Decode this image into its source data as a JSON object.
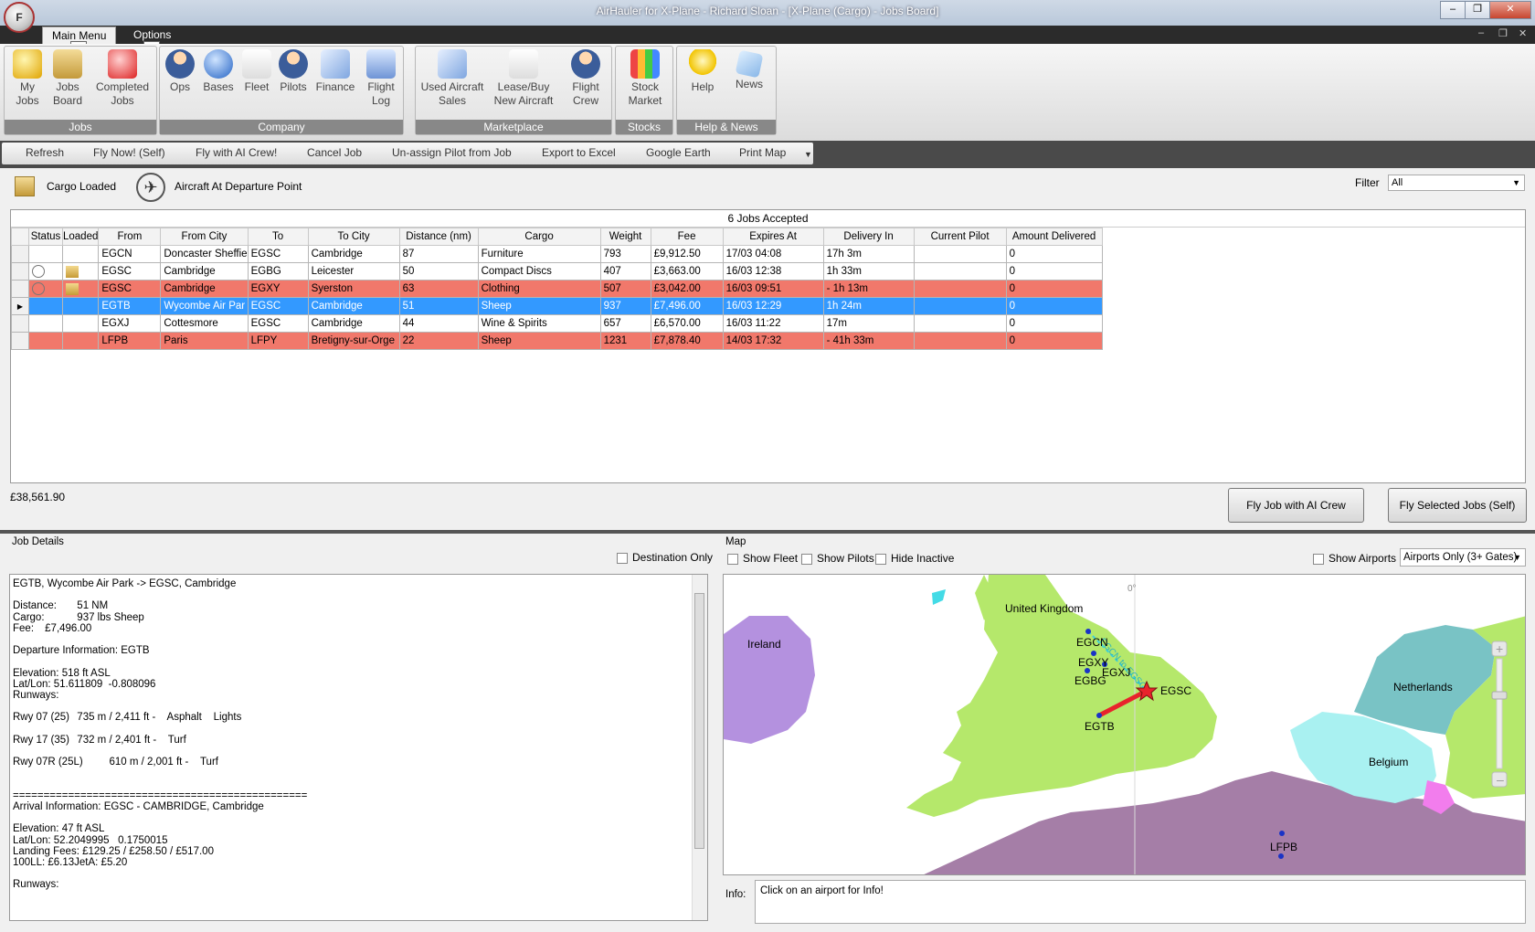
{
  "window": {
    "title": "AirHauler for X-Plane - Richard Sloan - [X-Plane (Cargo) - Jobs Board]",
    "app_icon_letter": "F"
  },
  "ribbon_tabs": {
    "main": "Main Menu",
    "options": "Options",
    "main_keytip": "M",
    "options_keytip": "O"
  },
  "ribbon": {
    "groups": {
      "jobs": "Jobs",
      "company": "Company",
      "marketplace": "Marketplace",
      "stocks": "Stocks",
      "help": "Help & News"
    },
    "buttons": {
      "my_jobs": [
        "My",
        "Jobs"
      ],
      "jobs_board": [
        "Jobs",
        "Board"
      ],
      "completed_jobs": [
        "Completed",
        "Jobs"
      ],
      "ops": "Ops",
      "bases": "Bases",
      "fleet": "Fleet",
      "pilots": "Pilots",
      "finance": "Finance",
      "flight_log": [
        "Flight",
        "Log"
      ],
      "used_aircraft": [
        "Used Aircraft",
        "Sales"
      ],
      "lease_buy": [
        "Lease/Buy",
        "New Aircraft"
      ],
      "flight_crew": [
        "Flight",
        "Crew"
      ],
      "stock_market": [
        "Stock",
        "Market"
      ],
      "help": "Help",
      "news": "News"
    }
  },
  "toolbar": [
    "Refresh",
    "Fly Now! (Self)",
    "Fly with AI Crew!",
    "Cancel Job",
    "Un-assign Pilot from Job",
    "Export to Excel",
    "Google Earth",
    "Print Map"
  ],
  "legend": {
    "cargo_loaded": "Cargo Loaded",
    "aircraft_at_departure": "Aircraft At Departure Point"
  },
  "filter": {
    "label": "Filter",
    "value": "All"
  },
  "grid": {
    "caption": "6 Jobs Accepted",
    "columns": [
      "Status",
      "Loaded",
      "From",
      "From City",
      "To",
      "To City",
      "Distance (nm)",
      "Cargo",
      "Weight",
      "Fee",
      "Expires At",
      "Delivery In",
      "Current Pilot",
      "Amount Delivered"
    ],
    "rows": [
      {
        "status": "",
        "loaded": "",
        "from": "EGCN",
        "from_city": "Doncaster Sheffie",
        "to": "EGSC",
        "to_city": "Cambridge",
        "distance": "87",
        "cargo": "Furniture",
        "weight": "793",
        "fee": "£9,912.50",
        "expires": "17/03 04:08",
        "delivery": "17h 3m",
        "pilot": "",
        "delivered": "0",
        "state": "normal"
      },
      {
        "status": "plane",
        "loaded": "box",
        "from": "EGSC",
        "from_city": "Cambridge",
        "to": "EGBG",
        "to_city": "Leicester",
        "distance": "50",
        "cargo": "Compact Discs",
        "weight": "407",
        "fee": "£3,663.00",
        "expires": "16/03 12:38",
        "delivery": "1h 33m",
        "pilot": "",
        "delivered": "0",
        "state": "normal"
      },
      {
        "status": "plane",
        "loaded": "box",
        "from": "EGSC",
        "from_city": "Cambridge",
        "to": "EGXY",
        "to_city": "Syerston",
        "distance": "63",
        "cargo": "Clothing",
        "weight": "507",
        "fee": "£3,042.00",
        "expires": "16/03 09:51",
        "delivery": "- 1h 13m",
        "pilot": "",
        "delivered": "0",
        "state": "overdue"
      },
      {
        "status": "",
        "loaded": "",
        "from": "EGTB",
        "from_city": "Wycombe Air Par",
        "to": "EGSC",
        "to_city": "Cambridge",
        "distance": "51",
        "cargo": "Sheep",
        "weight": "937",
        "fee": "£7,496.00",
        "expires": "16/03 12:29",
        "delivery": "1h 24m",
        "pilot": "",
        "delivered": "0",
        "state": "selected"
      },
      {
        "status": "",
        "loaded": "",
        "from": "EGXJ",
        "from_city": "Cottesmore",
        "to": "EGSC",
        "to_city": "Cambridge",
        "distance": "44",
        "cargo": "Wine & Spirits",
        "weight": "657",
        "fee": "£6,570.00",
        "expires": "16/03 11:22",
        "delivery": "17m",
        "pilot": "",
        "delivered": "0",
        "state": "normal"
      },
      {
        "status": "",
        "loaded": "",
        "from": "LFPB",
        "from_city": "Paris",
        "to": "LFPY",
        "to_city": "Bretigny-sur-Orge",
        "distance": "22",
        "cargo": "Sheep",
        "weight": "1231",
        "fee": "£7,878.40",
        "expires": "14/03 17:32",
        "delivery": "- 41h 33m",
        "pilot": "",
        "delivered": "0",
        "state": "overdue"
      }
    ]
  },
  "total": "£38,561.90",
  "buttons": {
    "fly_ai": "Fly Job with AI Crew",
    "fly_self": "Fly Selected Jobs (Self)"
  },
  "details": {
    "title": "Job Details",
    "destination_only": "Destination Only",
    "lines": [
      "EGTB, Wycombe Air Park -> EGSC, Cambridge",
      "",
      "Distance:\t51 NM",
      "Cargo:\t937 lbs Sheep",
      "Fee:\t£7,496.00",
      "",
      "Departure Information: EGTB",
      "",
      "Elevation: 518 ft ASL",
      "Lat/Lon: 51.611809  -0.808096",
      "Runways:",
      "",
      "Rwy 07 (25)\t735 m / 2,411 ft -    Asphalt    Lights",
      "",
      "Rwy 17 (35)\t732 m / 2,401 ft -    Turf",
      "",
      "Rwy 07R (25L)\t610 m / 2,001 ft -    Turf",
      "",
      "",
      "================================================",
      "Arrival Information: EGSC - CAMBRIDGE, Cambridge",
      "",
      "Elevation: 47 ft ASL",
      "Lat/Lon: 52.2049995   0.1750015",
      "Landing Fees: £129.25 / £258.50 / £517.00",
      "100LL: £6.13JetA: £5.20",
      "",
      "Runways:"
    ]
  },
  "map": {
    "title": "Map",
    "show_fleet": "Show Fleet",
    "show_pilots": "Show Pilots",
    "hide_inactive": "Hide Inactive",
    "show_airports": "Show Airports",
    "airport_filter": "Airports Only (3+ Gates)",
    "meridian": "0°",
    "labels": {
      "uk": "United Kingdom",
      "ireland": "Ireland",
      "netherlands": "Netherlands",
      "belgium": "Belgium"
    },
    "airports": [
      "EGCN",
      "EGXY",
      "EGXJ",
      "EGBG",
      "EGSC",
      "EGTB",
      "LFPB"
    ],
    "route_label": "EGCN to EGSC",
    "info_label": "Info:",
    "info_text": "Click on an airport for Info!",
    "colors": {
      "sea": "#ffffff",
      "uk": "#b5e86b",
      "ireland": "#b491df",
      "france": "#a57ea7",
      "belgium": "#a9f1f1",
      "netherlands": "#79c3c5",
      "selected_route": "#e8232c"
    }
  }
}
